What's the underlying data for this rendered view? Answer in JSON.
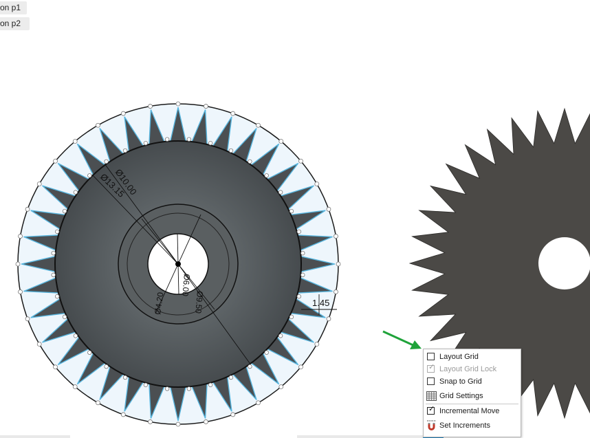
{
  "browser": {
    "tabs": [
      {
        "label": "on p1"
      },
      {
        "label": "on p2"
      }
    ]
  },
  "sketch": {
    "dimensions": {
      "outer_diameter": "Ø13.15",
      "inner_diameter": "Ø10.00",
      "hole_diameter": "Ø4.20",
      "hub_diameter": "Ø6.00",
      "ring_diameter": "Ø9.50",
      "tooth_depth": "1.45"
    },
    "tooth_count": 36
  },
  "context_menu": {
    "items": [
      {
        "label": "Layout Grid",
        "checked": false,
        "enabled": true
      },
      {
        "label": "Layout Grid Lock",
        "checked": true,
        "enabled": false
      },
      {
        "label": "Snap to Grid",
        "checked": false,
        "enabled": true
      },
      {
        "label": "Grid Settings",
        "icon": "grid-settings-icon",
        "enabled": true
      },
      {
        "label": "Incremental Move",
        "checked": true,
        "enabled": true
      },
      {
        "label": "Set Increments",
        "icon": "magnet-icon",
        "enabled": true
      }
    ]
  },
  "colors": {
    "part_body": "#4a4e50",
    "tooth_fill": "#4b4f52",
    "sketch_region": "#eef6fc",
    "sketch_line": "#58b6df",
    "arrow": "#1fa33a",
    "solid_gear": "#4b4946"
  }
}
